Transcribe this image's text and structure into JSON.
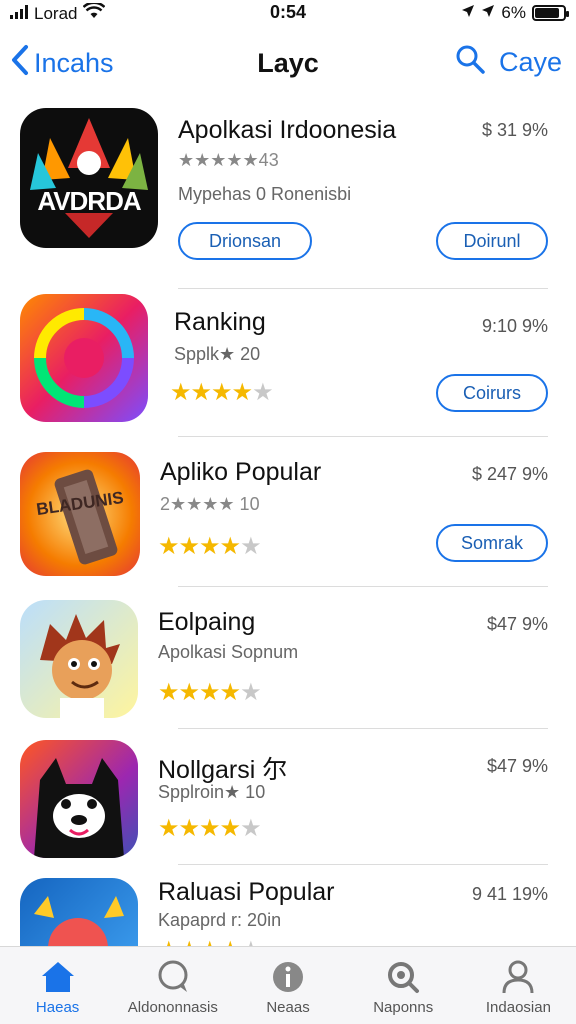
{
  "status_bar": {
    "carrier": "Lorad",
    "time": "0:54",
    "battery": "6%",
    "battery_level": 0.85
  },
  "nav": {
    "back_label": "Incahs",
    "title": "Layc",
    "right_label": "Caye"
  },
  "apps": [
    {
      "icon_name": "avdrda-app-icon",
      "icon_text": "AVDRDA",
      "name": "Apolkasi Irdoonesia",
      "price": "$ 31 9%",
      "sub1": "★★★★★43",
      "sub2": "Mypehas 0 Ronenisbi",
      "button_left": "Drionsan",
      "button_right": "Doirunl"
    },
    {
      "icon_name": "swirl-app-icon",
      "name": "Ranking",
      "price": "9:10 9%",
      "sub1": "Spplk★ 20",
      "rating": 4.5,
      "button_right": "Coirurs"
    },
    {
      "icon_name": "bladunis-game-icon",
      "icon_text": "BLADUNIS",
      "name": "Apliko Popular",
      "price": "$ 247 9%",
      "sub1": "2★★★★ 10",
      "rating": 4,
      "button_right": "Somrak"
    },
    {
      "icon_name": "cartoon-character-icon",
      "name": "Eolpaing",
      "price": "$47 9%",
      "sub1": "Apolkasi Sopnum",
      "rating": 4
    },
    {
      "icon_name": "dog-app-icon",
      "name": "Nollgarsi 尔",
      "price": "$47 9%",
      "sub1": "Spplroin★ 10",
      "rating": 4
    },
    {
      "icon_name": "bird-app-icon",
      "name": "Raluasi Popular",
      "price": "9 41 19%",
      "sub1": "Kapaprd r: 20in",
      "rating": 4
    }
  ],
  "tabs": [
    {
      "label": "Haeas",
      "icon": "home-icon",
      "active": true
    },
    {
      "label": "Aldononnasis",
      "icon": "chat-icon",
      "active": false
    },
    {
      "label": "Neaas",
      "icon": "info-icon",
      "active": false
    },
    {
      "label": "Naponns",
      "icon": "search-icon",
      "active": false
    },
    {
      "label": "Indaosian",
      "icon": "person-icon",
      "active": false
    }
  ],
  "colors": {
    "accent": "#1a73e8",
    "star": "#f5b800"
  }
}
